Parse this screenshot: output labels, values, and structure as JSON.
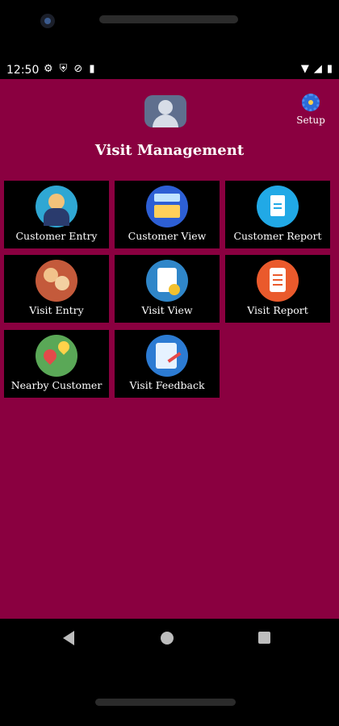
{
  "status_bar": {
    "time": "12:50",
    "left_icons": [
      "gear-icon",
      "shield-icon",
      "circle-slash-icon",
      "sim-icon"
    ],
    "right_icons": [
      "wifi-icon",
      "signal-icon",
      "battery-icon"
    ]
  },
  "colors": {
    "app_background": "#8a0040",
    "tile_background": "#000000"
  },
  "header": {
    "title": "Visit Management",
    "setup_label": "Setup"
  },
  "tiles": [
    {
      "label": "Customer Entry",
      "icon": "customer-entry-icon"
    },
    {
      "label": "Customer View",
      "icon": "customer-view-icon"
    },
    {
      "label": "Customer Report",
      "icon": "customer-report-icon"
    },
    {
      "label": "Visit Entry",
      "icon": "visit-entry-icon"
    },
    {
      "label": "Visit View",
      "icon": "visit-view-icon"
    },
    {
      "label": "Visit Report",
      "icon": "visit-report-icon"
    },
    {
      "label": "Nearby Customer",
      "icon": "nearby-customer-icon"
    },
    {
      "label": "Visit Feedback",
      "icon": "visit-feedback-icon"
    }
  ]
}
